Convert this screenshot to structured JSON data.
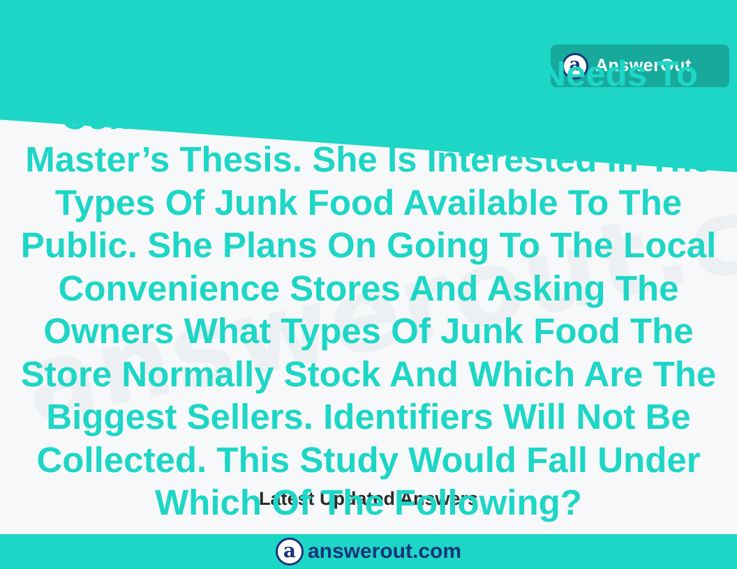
{
  "brand": {
    "logo_letter": "a",
    "badge_name": "AnswerOut",
    "domain": "answerout.com",
    "watermark": "answerout.com"
  },
  "question": {
    "text": "A Master’s Degree Candidate Needs To Conduct A Research Project For Her Master’s Thesis. She Is Interested In The Types Of Junk Food Available To The Public. She Plans On Going To The Local Convenience Stores And Asking The Owners What Types Of Junk Food The Store Normally Stock And Which Are The Biggest Sellers. Identifiers Will Not Be Collected. This Study Would Fall Under Which Of The Following?"
  },
  "section": {
    "latest_label": "Latest Updated Answers"
  },
  "colors": {
    "accent": "#1dd6c6",
    "badge": "#17a99c",
    "brand_navy": "#19337a",
    "background": "#f6f8f9"
  },
  "icons": {
    "logo": "answerout-logo-icon"
  }
}
